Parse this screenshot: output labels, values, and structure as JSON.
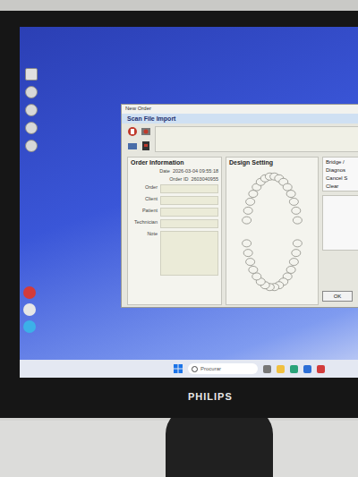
{
  "window": {
    "title": "New Order"
  },
  "scan_import": {
    "title": "Scan File Import"
  },
  "order_info": {
    "title": "Order Information",
    "date_label": "Date",
    "date": "2026-03-04 09:55:18",
    "order_id_label": "Order ID",
    "order_id": "2603040955",
    "fields": [
      {
        "label": "Order",
        "value": "",
        "kind": "line"
      },
      {
        "label": "Client",
        "value": "",
        "kind": "line"
      },
      {
        "label": "Patient",
        "value": "",
        "kind": "line"
      },
      {
        "label": "Technician",
        "value": "",
        "kind": "line"
      },
      {
        "label": "Note",
        "value": "",
        "kind": "area"
      }
    ]
  },
  "design": {
    "title": "Design Setting"
  },
  "options": [
    "Bridge /",
    "Diagnos",
    "Cancel S",
    "Clear"
  ],
  "buttons": [
    "OK"
  ],
  "taskbar": {
    "search_placeholder": "Procurar"
  },
  "monitor": {
    "brand": "PHILIPS"
  }
}
